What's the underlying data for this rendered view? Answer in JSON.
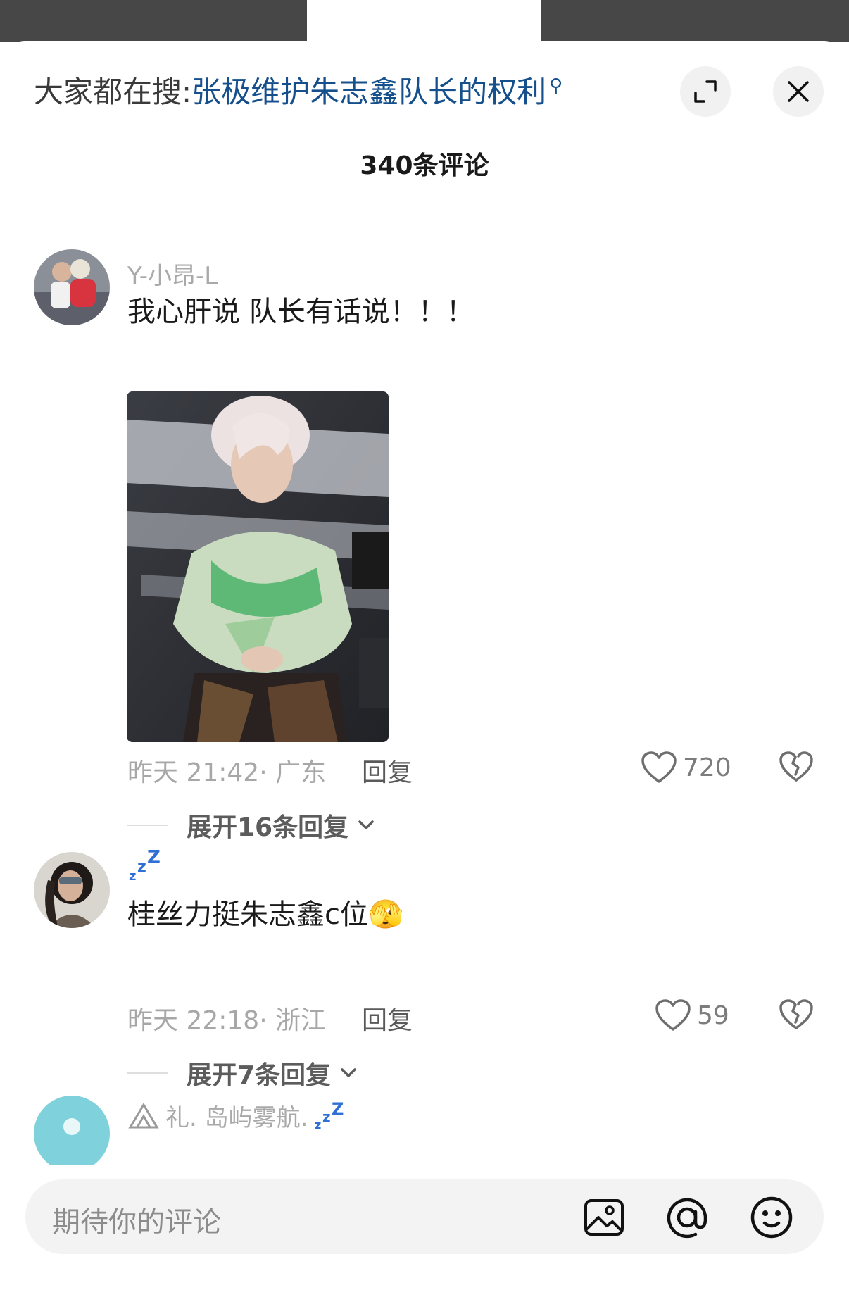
{
  "header": {
    "search_prefix": "大家都在搜:",
    "search_term": "张极维护朱志鑫队长的权利",
    "comment_count": "340条评论"
  },
  "comments": [
    {
      "username": "Y-小昂-L",
      "text": "我心肝说 队长有话说！！！",
      "has_image": true,
      "meta": "昨天 21:42· 广东",
      "reply_label": "回复",
      "likes": "720",
      "expand_label": "展开16条回复"
    },
    {
      "username": "zᶻZ",
      "text": "桂丝力挺朱志鑫c位🫣",
      "meta": "昨天 22:18· 浙江",
      "reply_label": "回复",
      "likes": "59",
      "expand_label": "展开7条回复"
    },
    {
      "username": "礼. 岛屿雾航."
    }
  ],
  "composer": {
    "placeholder": "期待你的评论"
  }
}
